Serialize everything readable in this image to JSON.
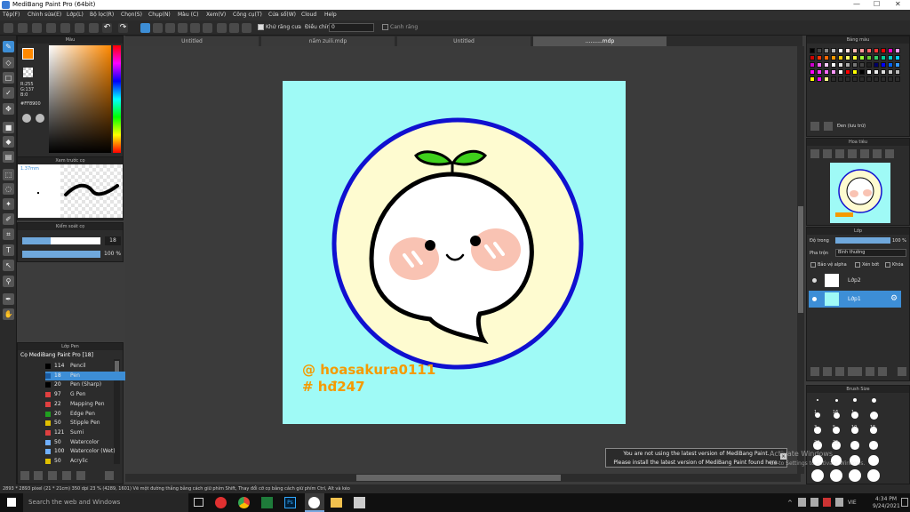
{
  "window": {
    "title": "MediBang Paint Pro (64bit)",
    "controls": [
      "—",
      "☐",
      "✕"
    ]
  },
  "menu": [
    "Tệp(F)",
    "Chỉnh sửa(E)",
    "Lớp(L)",
    "Bộ lọc(R)",
    "Chọn(S)",
    "Chụp(N)",
    "Màu (C)",
    "Xem(V)",
    "Công cụ(T)",
    "Cửa sổ(W)",
    "Cloud",
    "Help"
  ],
  "toolbar": {
    "antialias_label": "Khử răng cưa",
    "adjust_label": "Điều chỉnh",
    "adjust_value": "0",
    "snap_label": "Canh răng"
  },
  "panels": {
    "color": "Màu",
    "brush_preview": "Xem trước cọ",
    "brush_size_value": "1.37mm",
    "brush_control": "Kiểm soát cọ",
    "brush_list": "Lớp Pen",
    "palette": "Bảng màu",
    "navigator": "Hoa tiêu",
    "layers": "Lớp",
    "brush_size": "Brush Size"
  },
  "color_info": {
    "r": "R:255",
    "g": "G:137",
    "b": "B:0",
    "hex": "#FF8900"
  },
  "brush_control": {
    "size": "18",
    "opacity": "100 %"
  },
  "brush_group": "Cọ MediBang Paint Pro [18]",
  "brushes": [
    {
      "size": "114",
      "name": "Pencil",
      "color": "#000000"
    },
    {
      "size": "18",
      "name": "Pen",
      "color": "#1a5ca3",
      "selected": true
    },
    {
      "size": "20",
      "name": "Pen (Sharp)",
      "color": "#000000"
    },
    {
      "size": "97",
      "name": "G Pen",
      "color": "#e04040"
    },
    {
      "size": "22",
      "name": "Mapping Pen",
      "color": "#e04040"
    },
    {
      "size": "20",
      "name": "Edge Pen",
      "color": "#20a020"
    },
    {
      "size": "50",
      "name": "Stipple Pen",
      "color": "#e0c000"
    },
    {
      "size": "121",
      "name": "Sumi",
      "color": "#e04040"
    },
    {
      "size": "50",
      "name": "Watercolor",
      "color": "#70b0ff"
    },
    {
      "size": "100",
      "name": "Watercolor (Wet)",
      "color": "#70b0ff"
    },
    {
      "size": "50",
      "name": "Acrylic",
      "color": "#e0c000"
    }
  ],
  "tabs": [
    "Untitled",
    "nấm zuili.mdp",
    "Untitled",
    "..........mdp"
  ],
  "artwork": {
    "line1": "@ hoasakura0111",
    "line2": "# hđ247"
  },
  "palette_footer": "Đen (lưu trữ)",
  "layer_panel": {
    "opacity_label": "Độ trong",
    "opacity_value": "100 %",
    "blend_label": "Pha trộn",
    "blend_value": "Bình thường",
    "protect_alpha": "Bảo vệ alpha",
    "clip": "Xén bớt",
    "lock": "Khóa"
  },
  "layers": [
    {
      "name": "Lớp2",
      "selected": false
    },
    {
      "name": "Lớp1",
      "selected": true
    }
  ],
  "brush_sizes": [
    "1",
    "16",
    "1",
    "3",
    "5",
    "10",
    "15",
    "20",
    "25"
  ],
  "toast": {
    "line1": "You are not using the latest version of MediBang Paint.",
    "line2": "Please install the latest version of MediBang Paint found here."
  },
  "watermark": {
    "line1": "Activate Windows",
    "line2": "Go to Settings to activate Windows."
  },
  "status": "2893 * 2893 pixel (21 * 21cm) 350 dpi 23 % (4289, 1601) Vẽ một đường thẳng bằng cách giữ phím Shift, Thay đổi cỡ cọ bằng cách giữ phím Ctrl, Alt và kéo",
  "taskbar": {
    "search_placeholder": "Search the web and Windows",
    "lang": "VIE",
    "time": "4:34 PM",
    "date": "9/24/2021"
  },
  "colors": {
    "canvas_bg": "#9ffaf6",
    "circle_fill": "#fefbd0",
    "circle_border": "#1010d0",
    "leaf": "#3fd01c",
    "text_orange": "#f59a00",
    "blush": "#f9c3b3",
    "accent": "#3d8ed6"
  }
}
